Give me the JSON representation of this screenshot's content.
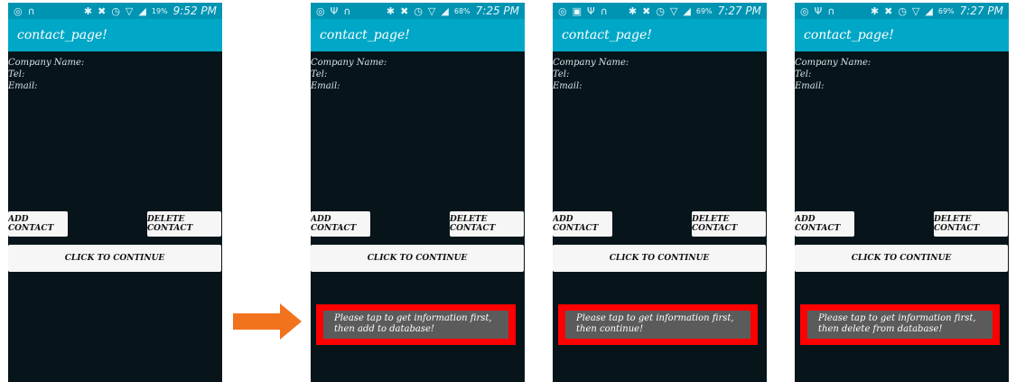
{
  "colors": {
    "status_bar": "#0094b3",
    "app_bar": "#00a7c6",
    "screen_bg": "#07151b",
    "button_bg": "#f6f6f6",
    "toast_bg": "#5b5b5b",
    "highlight": "#ff0000",
    "arrow": "#f2731d"
  },
  "app": {
    "title": "contact_page!",
    "fields": {
      "company": "Company Name:",
      "tel": "Tel:",
      "email": "Email:"
    },
    "buttons": {
      "add": "ADD CONTACT",
      "delete": "DELETE CONTACT",
      "continue": "CLICK TO CONTINUE"
    }
  },
  "screens": [
    {
      "time": "9:52 PM",
      "battery": "19%"
    },
    {
      "time": "7:25 PM",
      "battery": "68%",
      "toast_line1": "Please tap to get information first,",
      "toast_line2": "then add to database!"
    },
    {
      "time": "7:27 PM",
      "battery": "69%",
      "toast_line1": "Please tap to get information first,",
      "toast_line2": "then continue!"
    },
    {
      "time": "7:27 PM",
      "battery": "69%",
      "toast_line1": "Please tap to get information first,",
      "toast_line2": "then delete from database!"
    }
  ],
  "icons": [
    "bluetooth-icon",
    "mute-icon",
    "alarm-icon",
    "wifi-icon",
    "signal-icon",
    "battery-icon",
    "arrow-right-icon"
  ]
}
